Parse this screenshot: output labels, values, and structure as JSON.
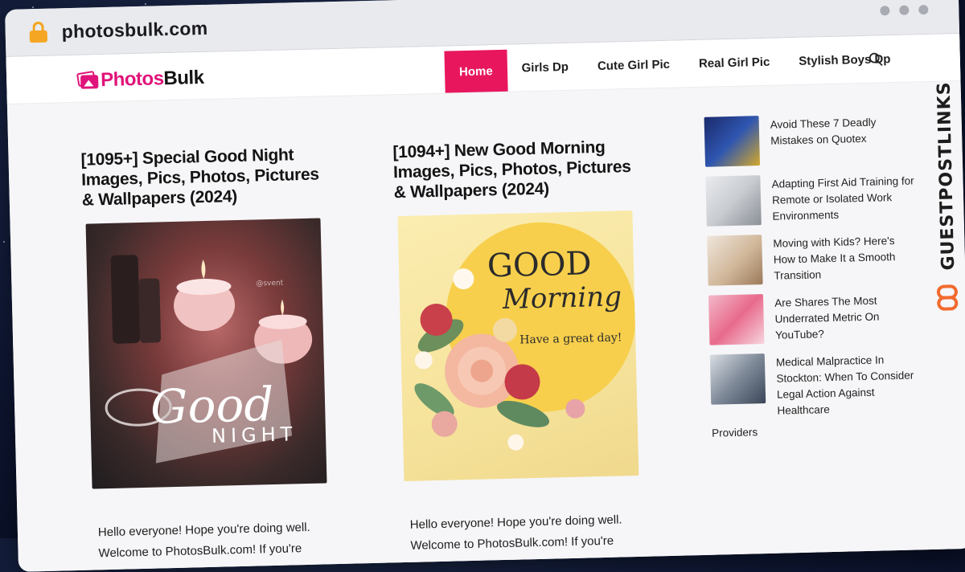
{
  "browser": {
    "url": "photosbulk.com"
  },
  "site": {
    "logo_part1": "Photos",
    "logo_part2": "Bulk"
  },
  "nav": {
    "items": [
      {
        "label": "Home",
        "active": true
      },
      {
        "label": "Girls Dp",
        "active": false
      },
      {
        "label": "Cute Girl Pic",
        "active": false
      },
      {
        "label": "Real Girl Pic",
        "active": false
      },
      {
        "label": "Stylish Boys Dp",
        "active": false
      }
    ]
  },
  "posts": [
    {
      "title": "[1095+] Special Good Night Images, Pics, Photos, Pictures & Wallpapers (2024)",
      "image_caption_1": "Good",
      "image_caption_2": "NIGHT",
      "image_watermark": "@svent",
      "excerpt_line1": "Hello everyone! Hope you're doing well.",
      "excerpt_line2": "Welcome to PhotosBulk.com! If you're"
    },
    {
      "title": "[1094+] New Good Morning Images, Pics, Photos, Pictures & Wallpapers (2024)",
      "image_caption_1": "GOOD",
      "image_caption_2": "Morning",
      "image_caption_3": "Have a great day!",
      "excerpt_line1": "Hello everyone! Hope you're doing well.",
      "excerpt_line2": "Welcome to PhotosBulk.com! If you're"
    }
  ],
  "sidebar": {
    "items": [
      {
        "title": "Avoid These 7 Deadly Mistakes on Quotex"
      },
      {
        "title": "Adapting First Aid Training for Remote or Isolated Work Environments"
      },
      {
        "title": "Moving with Kids? Here's How to Make It a Smooth Transition"
      },
      {
        "title": "Are Shares The Most Underrated Metric On YouTube?"
      },
      {
        "title": "Medical Malpractice In Stockton: When To Consider Legal Action Against Healthcare"
      }
    ],
    "trailing_text": "Providers"
  },
  "watermark": {
    "text": "GUESTPOSTLINKS"
  },
  "colors": {
    "accent": "#e8175d",
    "brand_pink": "#e0147a",
    "watermark_orange": "#f26a2e"
  }
}
